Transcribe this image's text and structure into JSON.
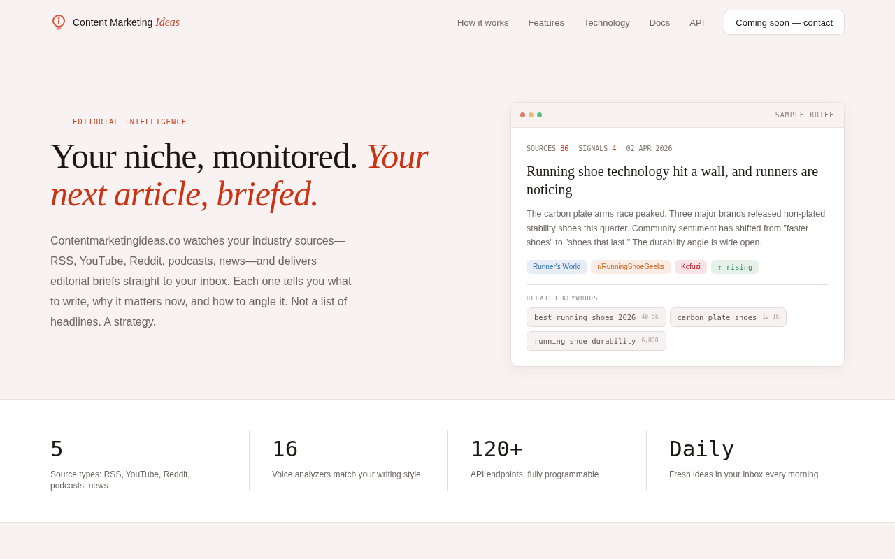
{
  "header": {
    "brand": "Content Marketing *Ideas*",
    "nav": [
      "How it works",
      "Features",
      "Technology",
      "Docs",
      "API"
    ],
    "cta": "Coming soon — contact"
  },
  "hero": {
    "eyebrow": "EDITORIAL INTELLIGENCE",
    "headline": "Your niche, monitored. *Your next article, briefed.*",
    "intro": "Contentmarketingideas.co watches your industry sources—RSS, YouTube, Reddit, podcasts, news—and delivers editorial briefs straight to your inbox. Each one tells you what to write, why it matters now, and how to angle it. Not a list of headlines. A strategy."
  },
  "brief_card": {
    "label": "SAMPLE BRIEF",
    "meta": [
      {
        "label": "SOURCES",
        "value": "86"
      },
      {
        "label": "SIGNALS",
        "value": "4"
      }
    ],
    "date": "02 APR 2026",
    "title": "Running shoe technology hit a wall, and runners are noticing",
    "summary": "The carbon plate arms race peaked. Three major brands released non-plated stability shoes this quarter. Community sentiment has shifted from \"faster shoes\" to \"shoes that last.\" The durability angle is wide open.",
    "tags": [
      {
        "kind": "source",
        "text": "Runner's World",
        "color": "#2f6db0"
      },
      {
        "kind": "source",
        "text": "r/RunningShoeGeeks",
        "color": "#cf6420"
      },
      {
        "kind": "source",
        "text": "Kofuzi",
        "color": "#c2202e"
      },
      {
        "kind": "trend",
        "text": "↑ rising",
        "color": "#2e8a55"
      }
    ],
    "keywords_label": "RELATED KEYWORDS",
    "keywords": [
      {
        "text": "best running shoes 2026",
        "count": "40.5k"
      },
      {
        "text": "carbon plate shoes",
        "count": "12.1k"
      },
      {
        "text": "running shoe durability",
        "count": "6,800"
      }
    ]
  },
  "stats": [
    {
      "value": "5",
      "label": "Source types: RSS, YouTube, Reddit, podcasts, news"
    },
    {
      "value": "16",
      "label": "Voice analyzers match your writing style"
    },
    {
      "value": "120+",
      "label": "API endpoints, fully programmable"
    },
    {
      "value": "Daily",
      "label": "Fresh ideas in your inbox every morning"
    }
  ]
}
